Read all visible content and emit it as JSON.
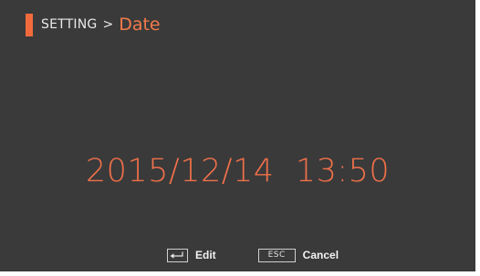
{
  "header": {
    "root": "SETTING",
    "separator": ">",
    "current": "Date"
  },
  "datetime": {
    "value": "2015/12/14  13:50"
  },
  "footer": {
    "edit": {
      "key_icon": "enter-key-icon",
      "label": "Edit"
    },
    "cancel": {
      "key": "ESC",
      "label": "Cancel"
    }
  },
  "colors": {
    "background": "#3a3a3a",
    "accent": "#f26a3c",
    "text": "#e9e9e9"
  }
}
